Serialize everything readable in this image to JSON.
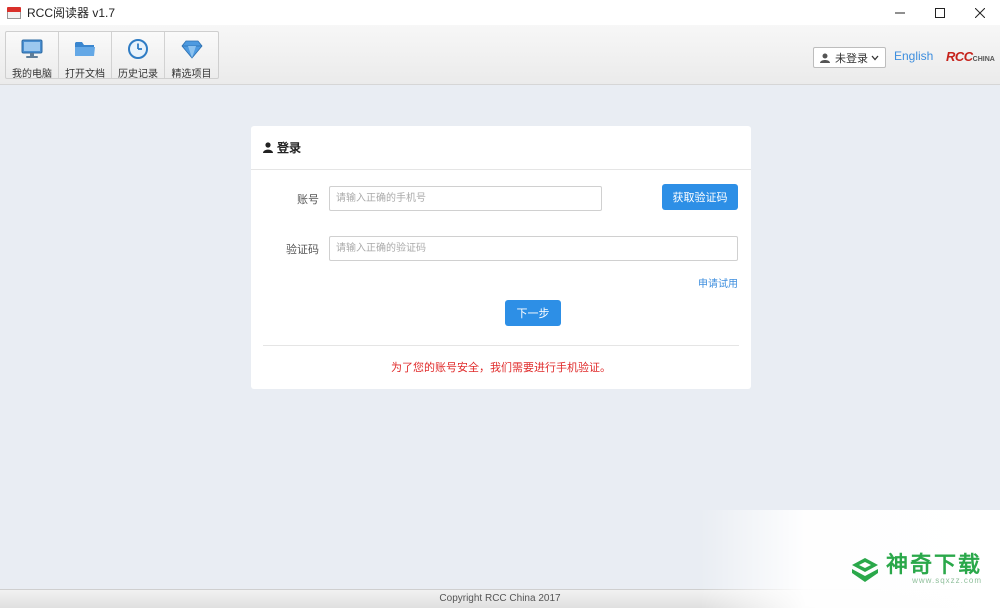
{
  "window": {
    "title": "RCC阅读器 v1.7",
    "controls": [
      "minimize-icon",
      "maximize-icon",
      "close-icon"
    ]
  },
  "toolbar": {
    "items": [
      {
        "label": "我的电脑",
        "icon": "computer-icon"
      },
      {
        "label": "打开文档",
        "icon": "folder-icon"
      },
      {
        "label": "历史记录",
        "icon": "clock-icon"
      },
      {
        "label": "精选项目",
        "icon": "diamond-icon"
      }
    ],
    "user_menu": "未登录",
    "language_link": "English",
    "logo_main": "RCC",
    "logo_sub": "CHINA"
  },
  "login": {
    "title": "登录",
    "account_label": "账号",
    "account_placeholder": "请输入正确的手机号",
    "get_code_button": "获取验证码",
    "code_label": "验证码",
    "code_placeholder": "请输入正确的验证码",
    "apply_trial_link": "申请试用",
    "next_button": "下一步",
    "notice": "为了您的账号安全，我们需要进行手机验证。"
  },
  "footer": {
    "copyright": "Copyright RCC China 2017"
  },
  "watermark": {
    "text": "神奇下载",
    "url": "www.sqxzz.com"
  },
  "colors": {
    "background": "#e9edf3",
    "primary_button": "#2d8fe6",
    "link": "#3d8ede",
    "notice": "#e02b2b",
    "brand": "#c6231c",
    "watermark": "#2aa84a"
  }
}
